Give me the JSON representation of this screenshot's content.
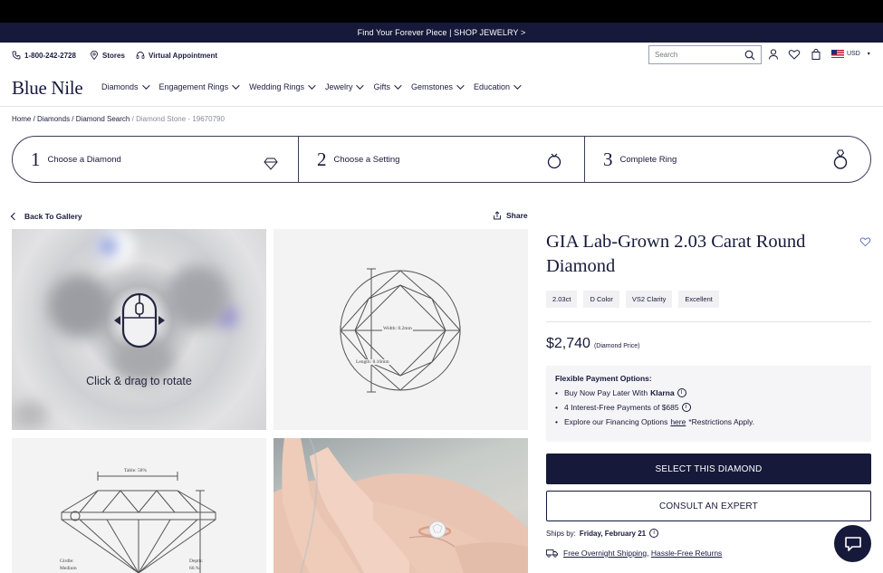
{
  "promo": {
    "text": "Find Your Forever Piece | SHOP JEWELRY >"
  },
  "utility": {
    "phone": "1-800-242-2728",
    "stores": "Stores",
    "appointment": "Virtual Appointment",
    "search_placeholder": "Search",
    "currency": "USD"
  },
  "nav": {
    "logo": "Blue Nile",
    "items": [
      {
        "label": "Diamonds"
      },
      {
        "label": "Engagement Rings"
      },
      {
        "label": "Wedding Rings"
      },
      {
        "label": "Jewelry"
      },
      {
        "label": "Gifts"
      },
      {
        "label": "Gemstones"
      },
      {
        "label": "Education"
      }
    ]
  },
  "breadcrumb": {
    "home": "Home",
    "diamonds": "Diamonds",
    "search": "Diamond Search",
    "current": "Diamond Stone - 19670790",
    "sep": "/"
  },
  "steps": [
    {
      "num": "1",
      "label": "Choose a Diamond"
    },
    {
      "num": "2",
      "label": "Choose a Setting"
    },
    {
      "num": "3",
      "label": "Complete Ring"
    }
  ],
  "gallery": {
    "back": "Back To Gallery",
    "share": "Share",
    "rotate_hint": "Click & drag to rotate",
    "top_width_label": "Width: 8.2mm",
    "top_length_label": "Length: 8.16mm",
    "table_label": "Table: 58%",
    "girdle_label": "Girdle:",
    "girdle_value": "Medium",
    "depth_label": "Depth:",
    "depth_value": "60.%"
  },
  "product": {
    "title": "GIA Lab-Grown 2.03 Carat Round Diamond",
    "chips": [
      "2.03ct",
      "D Color",
      "VS2 Clarity",
      "Excellent"
    ],
    "price": "$2,740",
    "price_note": "(Diamond Price)"
  },
  "finance": {
    "heading": "Flexible Payment Options:",
    "line1": "Buy Now Pay Later With",
    "klarna": "Klarna",
    "line2": "4 Interest-Free Payments of $685",
    "line3_pre": "Explore our Financing Options",
    "line3_link": "here",
    "line3_post": "*Restrictions Apply."
  },
  "actions": {
    "select": "SELECT THIS DIAMOND",
    "consult": "CONSULT AN EXPERT"
  },
  "shipping": {
    "ships_label": "Ships by:",
    "ships_date": "Friday, February 21",
    "free_shipping": "Free Overnight Shipping",
    "comma": ",",
    "returns": "Hassle-Free Returns"
  },
  "colors": {
    "navy": "#16193a",
    "accent": "#16193a"
  }
}
